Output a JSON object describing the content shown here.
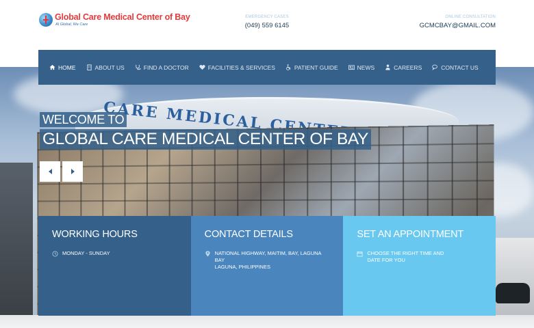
{
  "brand": {
    "name": "Global Care Medical Center of Bay",
    "tagline": "At Global, We Care"
  },
  "header": {
    "emergency_label": "EMERGENCY CASES",
    "emergency_value": "(049) 559 6145",
    "online_label": "ONLINE CONSULTATION",
    "online_value": "GCMCBAY@GMAIL.COM"
  },
  "nav": {
    "items": [
      {
        "label": "HOME",
        "icon": "home-icon",
        "active": true
      },
      {
        "label": "ABOUT US",
        "icon": "building-icon"
      },
      {
        "label": "FIND A DOCTOR",
        "icon": "stethoscope-icon"
      },
      {
        "label": "FACILITIES & SERVICES",
        "icon": "heart-icon"
      },
      {
        "label": "PATIENT GUIDE",
        "icon": "wheelchair-icon"
      },
      {
        "label": "NEWS",
        "icon": "newspaper-icon"
      },
      {
        "label": "CAREERS",
        "icon": "user-tie-icon"
      },
      {
        "label": "CONTACT US",
        "icon": "chat-icon"
      }
    ]
  },
  "hero": {
    "line1": "WELCOME TO",
    "line2": "GLOBAL CARE MEDICAL CENTER OF BAY",
    "sign_text": "CARE MEDICAL CENTER OF BAY"
  },
  "boxes": {
    "hours": {
      "title": "WORKING HOURS",
      "text": "MONDAY - SUNDAY",
      "icon": "clock-icon"
    },
    "contact": {
      "title": "CONTACT DETAILS",
      "line1": "NATIONAL HIGHWAY, MAITIM, BAY, LAGUNA",
      "line2": "BAY",
      "line3": "LAGUNA, PHILIPPINES",
      "icon": "map-marker-icon"
    },
    "appointment": {
      "title": "SET AN APPOINTMENT",
      "line1": "CHOOSE THE RIGHT TIME AND",
      "line2": "DATE FOR YOU",
      "icon": "calendar-icon"
    }
  },
  "colors": {
    "nav_bg": "#34608a",
    "box_hours": "#34608a",
    "box_contact": "#4a86bd",
    "box_appointment": "#69c8f0",
    "logo_red": "#e33a3a"
  }
}
